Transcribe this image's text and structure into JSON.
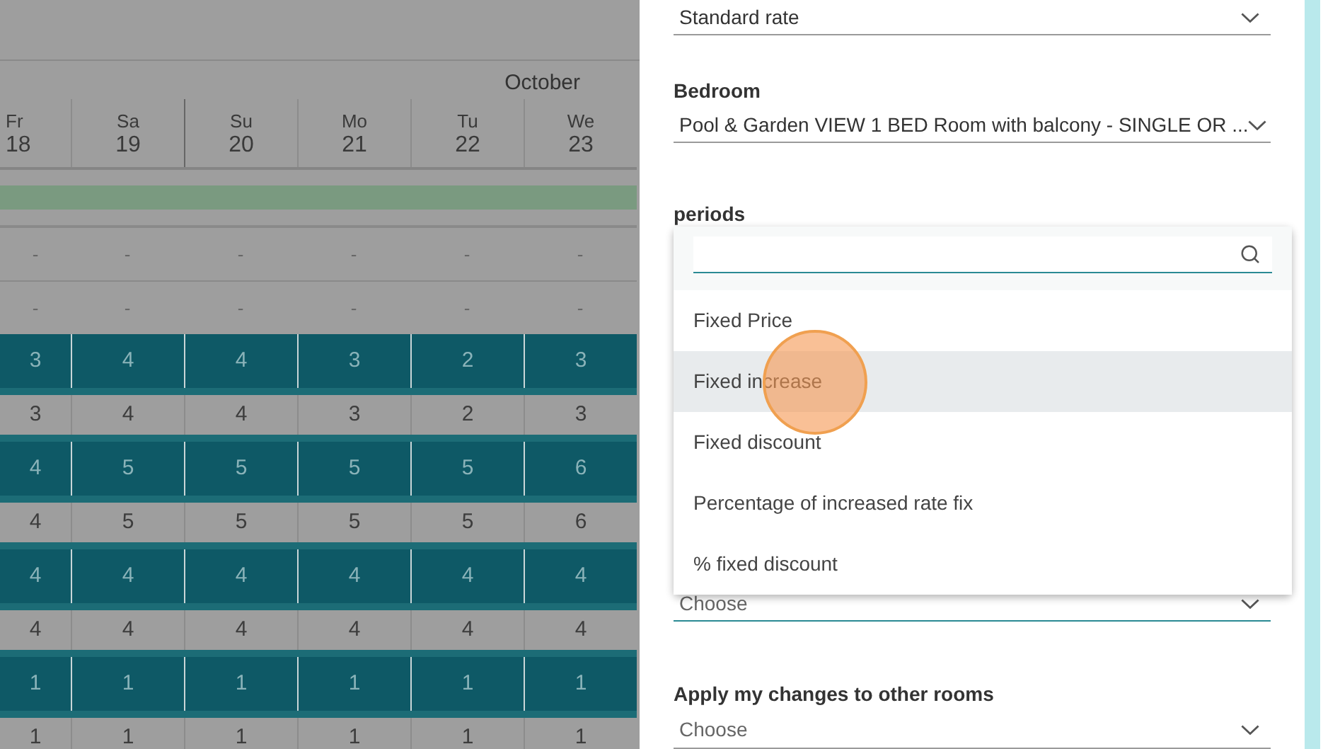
{
  "calendar": {
    "month": "October",
    "days": [
      {
        "dow": "Fr",
        "date": "18"
      },
      {
        "dow": "Sa",
        "date": "19"
      },
      {
        "dow": "Su",
        "date": "20"
      },
      {
        "dow": "Mo",
        "date": "21"
      },
      {
        "dow": "Tu",
        "date": "22"
      },
      {
        "dow": "We",
        "date": "23"
      }
    ],
    "rows": [
      {
        "kind": "band"
      },
      {
        "kind": "plain",
        "cells": [
          "-",
          "-",
          "-",
          "-",
          "-",
          "-"
        ]
      },
      {
        "kind": "plain",
        "cells": [
          "-",
          "-",
          "-",
          "-",
          "-",
          "-"
        ]
      },
      {
        "kind": "teal",
        "cells": [
          "3",
          "4",
          "4",
          "3",
          "2",
          "3"
        ]
      },
      {
        "kind": "grey",
        "cells": [
          "3",
          "4",
          "4",
          "3",
          "2",
          "3"
        ]
      },
      {
        "kind": "teal",
        "cells": [
          "4",
          "5",
          "5",
          "5",
          "5",
          "6"
        ]
      },
      {
        "kind": "grey",
        "cells": [
          "4",
          "5",
          "5",
          "5",
          "5",
          "6"
        ]
      },
      {
        "kind": "teal",
        "cells": [
          "4",
          "4",
          "4",
          "4",
          "4",
          "4"
        ]
      },
      {
        "kind": "grey",
        "cells": [
          "4",
          "4",
          "4",
          "4",
          "4",
          "4"
        ]
      },
      {
        "kind": "teal",
        "cells": [
          "1",
          "1",
          "1",
          "1",
          "1",
          "1"
        ]
      },
      {
        "kind": "grey",
        "cells": [
          "1",
          "1",
          "1",
          "1",
          "1",
          "1"
        ]
      }
    ]
  },
  "panel": {
    "rate_field": {
      "value": "Standard rate"
    },
    "bedroom": {
      "label": "Bedroom",
      "value": "Pool & Garden VIEW 1 BED Room with balcony - SINGLE OR ..."
    },
    "periods": {
      "label": "periods"
    },
    "dropdown": {
      "options": [
        {
          "label": "Fixed Price",
          "selected": false
        },
        {
          "label": "Fixed increase",
          "selected": true
        },
        {
          "label": "Fixed discount",
          "selected": false
        },
        {
          "label": "Percentage of increased rate fix",
          "selected": false
        },
        {
          "label": "% fixed discount",
          "selected": false
        }
      ]
    },
    "type_field": {
      "placeholder": "Choose"
    },
    "other_rooms": {
      "label": "Apply my changes to other rooms",
      "placeholder": "Choose"
    }
  }
}
